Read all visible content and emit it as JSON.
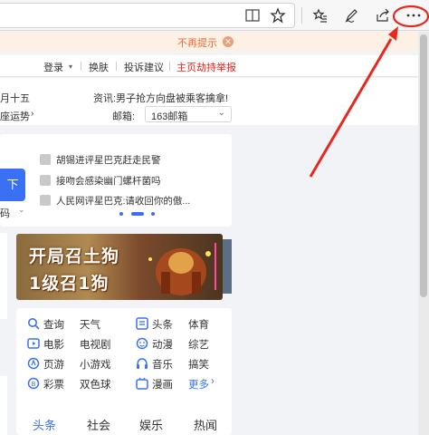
{
  "toolbar": {
    "icons": [
      "reading-view-icon",
      "favorite-star-icon",
      "favorites-hub-icon",
      "pen-notes-icon",
      "share-icon",
      "more-icon"
    ]
  },
  "notice": {
    "text": "不再提示"
  },
  "topnav": {
    "login": "登录",
    "skin": "换肤",
    "feedback": "投诉建议",
    "report": "主页劫持举报"
  },
  "header": {
    "date": "月十五",
    "fortune": "座运势",
    "headline": "资讯:男子抢方向盘被乘客擒拿!",
    "mail_label": "邮箱:",
    "mail_value": "163邮箱",
    "mail_chevron": "⌄"
  },
  "news": {
    "items": [
      "胡锡进评星巴克赶走民警",
      "接吻会感染幽门螺杆菌吗",
      "人民网评星巴克:请收回你的傲..."
    ],
    "left_btn": "下",
    "left_frag": "码",
    "left_frag_chev": "⌄"
  },
  "banner": {
    "line1": "开局召土狗",
    "line2": "1级召1狗"
  },
  "quicklinks": [
    {
      "label": "查询",
      "icon": "search-icon"
    },
    {
      "label": "天气",
      "icon": "none"
    },
    {
      "label": "头条",
      "icon": "headlines-icon"
    },
    {
      "label": "体育",
      "icon": "none"
    },
    {
      "label": "电影",
      "icon": "movie-icon"
    },
    {
      "label": "电视剧",
      "icon": "none"
    },
    {
      "label": "动漫",
      "icon": "anime-icon"
    },
    {
      "label": "综艺",
      "icon": "none"
    },
    {
      "label": "页游",
      "icon": "webgame-icon"
    },
    {
      "label": "小游戏",
      "icon": "none"
    },
    {
      "label": "音乐",
      "icon": "music-icon"
    },
    {
      "label": "搞笑",
      "icon": "none"
    },
    {
      "label": "彩票",
      "icon": "lottery-icon"
    },
    {
      "label": "双色球",
      "icon": "none"
    },
    {
      "label": "漫画",
      "icon": "comic-icon"
    },
    {
      "label": "更多",
      "icon": "more-arrow-icon"
    }
  ],
  "more_arrow": "›",
  "tabs": [
    "头条",
    "社会",
    "娱乐",
    "热闻"
  ],
  "colors": {
    "accent": "#3a71f4",
    "annotation": "#e8271e",
    "notice_text": "#e0703a",
    "report_link": "#e0241b"
  }
}
